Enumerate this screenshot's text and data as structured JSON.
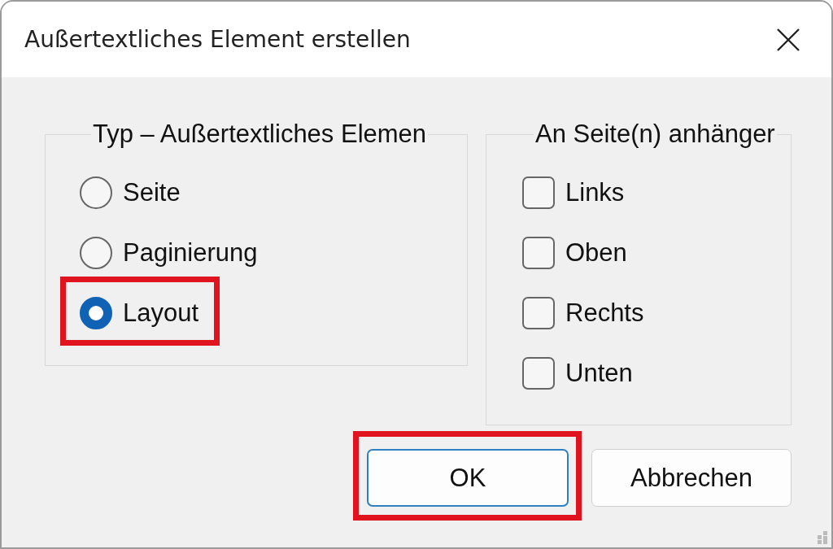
{
  "window": {
    "title": "Außertextliches Element erstellen"
  },
  "type_group": {
    "legend": "Typ – Außertextliches Elemen",
    "options": [
      {
        "label": "Seite",
        "selected": false,
        "highlighted": false
      },
      {
        "label": "Paginierung",
        "selected": false,
        "highlighted": false
      },
      {
        "label": "Layout",
        "selected": true,
        "highlighted": true
      }
    ]
  },
  "attach_group": {
    "legend": "An Seite(n) anhänger",
    "options": [
      {
        "label": "Links",
        "checked": false
      },
      {
        "label": "Oben",
        "checked": false
      },
      {
        "label": "Rechts",
        "checked": false
      },
      {
        "label": "Unten",
        "checked": false
      }
    ]
  },
  "buttons": [
    {
      "label": "OK",
      "default": true,
      "highlighted": true
    },
    {
      "label": "Abbrechen",
      "default": false,
      "highlighted": false
    }
  ]
}
